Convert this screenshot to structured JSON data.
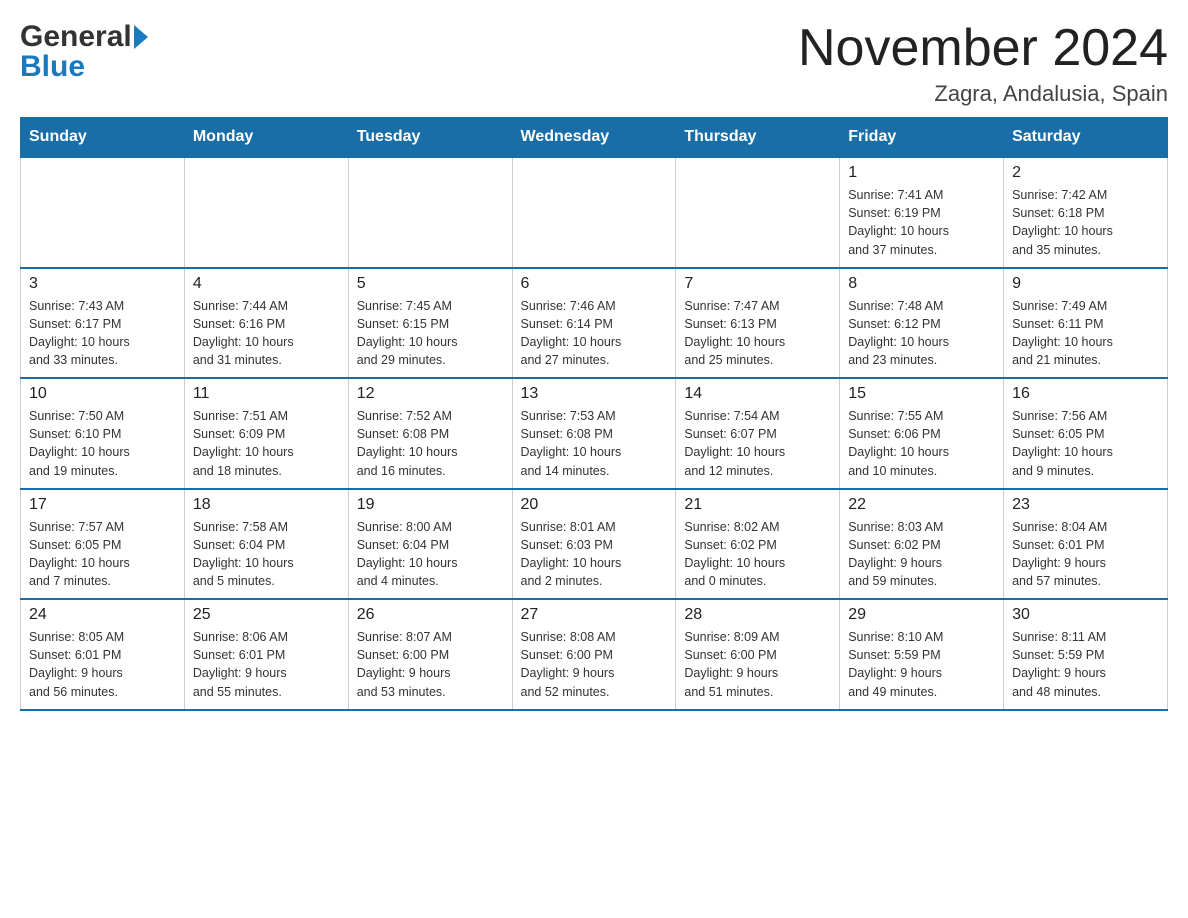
{
  "header": {
    "month_year": "November 2024",
    "location": "Zagra, Andalusia, Spain",
    "logo_general": "General",
    "logo_blue": "Blue"
  },
  "days_of_week": [
    "Sunday",
    "Monday",
    "Tuesday",
    "Wednesday",
    "Thursday",
    "Friday",
    "Saturday"
  ],
  "weeks": [
    [
      {
        "day": "",
        "info": ""
      },
      {
        "day": "",
        "info": ""
      },
      {
        "day": "",
        "info": ""
      },
      {
        "day": "",
        "info": ""
      },
      {
        "day": "",
        "info": ""
      },
      {
        "day": "1",
        "info": "Sunrise: 7:41 AM\nSunset: 6:19 PM\nDaylight: 10 hours\nand 37 minutes."
      },
      {
        "day": "2",
        "info": "Sunrise: 7:42 AM\nSunset: 6:18 PM\nDaylight: 10 hours\nand 35 minutes."
      }
    ],
    [
      {
        "day": "3",
        "info": "Sunrise: 7:43 AM\nSunset: 6:17 PM\nDaylight: 10 hours\nand 33 minutes."
      },
      {
        "day": "4",
        "info": "Sunrise: 7:44 AM\nSunset: 6:16 PM\nDaylight: 10 hours\nand 31 minutes."
      },
      {
        "day": "5",
        "info": "Sunrise: 7:45 AM\nSunset: 6:15 PM\nDaylight: 10 hours\nand 29 minutes."
      },
      {
        "day": "6",
        "info": "Sunrise: 7:46 AM\nSunset: 6:14 PM\nDaylight: 10 hours\nand 27 minutes."
      },
      {
        "day": "7",
        "info": "Sunrise: 7:47 AM\nSunset: 6:13 PM\nDaylight: 10 hours\nand 25 minutes."
      },
      {
        "day": "8",
        "info": "Sunrise: 7:48 AM\nSunset: 6:12 PM\nDaylight: 10 hours\nand 23 minutes."
      },
      {
        "day": "9",
        "info": "Sunrise: 7:49 AM\nSunset: 6:11 PM\nDaylight: 10 hours\nand 21 minutes."
      }
    ],
    [
      {
        "day": "10",
        "info": "Sunrise: 7:50 AM\nSunset: 6:10 PM\nDaylight: 10 hours\nand 19 minutes."
      },
      {
        "day": "11",
        "info": "Sunrise: 7:51 AM\nSunset: 6:09 PM\nDaylight: 10 hours\nand 18 minutes."
      },
      {
        "day": "12",
        "info": "Sunrise: 7:52 AM\nSunset: 6:08 PM\nDaylight: 10 hours\nand 16 minutes."
      },
      {
        "day": "13",
        "info": "Sunrise: 7:53 AM\nSunset: 6:08 PM\nDaylight: 10 hours\nand 14 minutes."
      },
      {
        "day": "14",
        "info": "Sunrise: 7:54 AM\nSunset: 6:07 PM\nDaylight: 10 hours\nand 12 minutes."
      },
      {
        "day": "15",
        "info": "Sunrise: 7:55 AM\nSunset: 6:06 PM\nDaylight: 10 hours\nand 10 minutes."
      },
      {
        "day": "16",
        "info": "Sunrise: 7:56 AM\nSunset: 6:05 PM\nDaylight: 10 hours\nand 9 minutes."
      }
    ],
    [
      {
        "day": "17",
        "info": "Sunrise: 7:57 AM\nSunset: 6:05 PM\nDaylight: 10 hours\nand 7 minutes."
      },
      {
        "day": "18",
        "info": "Sunrise: 7:58 AM\nSunset: 6:04 PM\nDaylight: 10 hours\nand 5 minutes."
      },
      {
        "day": "19",
        "info": "Sunrise: 8:00 AM\nSunset: 6:04 PM\nDaylight: 10 hours\nand 4 minutes."
      },
      {
        "day": "20",
        "info": "Sunrise: 8:01 AM\nSunset: 6:03 PM\nDaylight: 10 hours\nand 2 minutes."
      },
      {
        "day": "21",
        "info": "Sunrise: 8:02 AM\nSunset: 6:02 PM\nDaylight: 10 hours\nand 0 minutes."
      },
      {
        "day": "22",
        "info": "Sunrise: 8:03 AM\nSunset: 6:02 PM\nDaylight: 9 hours\nand 59 minutes."
      },
      {
        "day": "23",
        "info": "Sunrise: 8:04 AM\nSunset: 6:01 PM\nDaylight: 9 hours\nand 57 minutes."
      }
    ],
    [
      {
        "day": "24",
        "info": "Sunrise: 8:05 AM\nSunset: 6:01 PM\nDaylight: 9 hours\nand 56 minutes."
      },
      {
        "day": "25",
        "info": "Sunrise: 8:06 AM\nSunset: 6:01 PM\nDaylight: 9 hours\nand 55 minutes."
      },
      {
        "day": "26",
        "info": "Sunrise: 8:07 AM\nSunset: 6:00 PM\nDaylight: 9 hours\nand 53 minutes."
      },
      {
        "day": "27",
        "info": "Sunrise: 8:08 AM\nSunset: 6:00 PM\nDaylight: 9 hours\nand 52 minutes."
      },
      {
        "day": "28",
        "info": "Sunrise: 8:09 AM\nSunset: 6:00 PM\nDaylight: 9 hours\nand 51 minutes."
      },
      {
        "day": "29",
        "info": "Sunrise: 8:10 AM\nSunset: 5:59 PM\nDaylight: 9 hours\nand 49 minutes."
      },
      {
        "day": "30",
        "info": "Sunrise: 8:11 AM\nSunset: 5:59 PM\nDaylight: 9 hours\nand 48 minutes."
      }
    ]
  ]
}
